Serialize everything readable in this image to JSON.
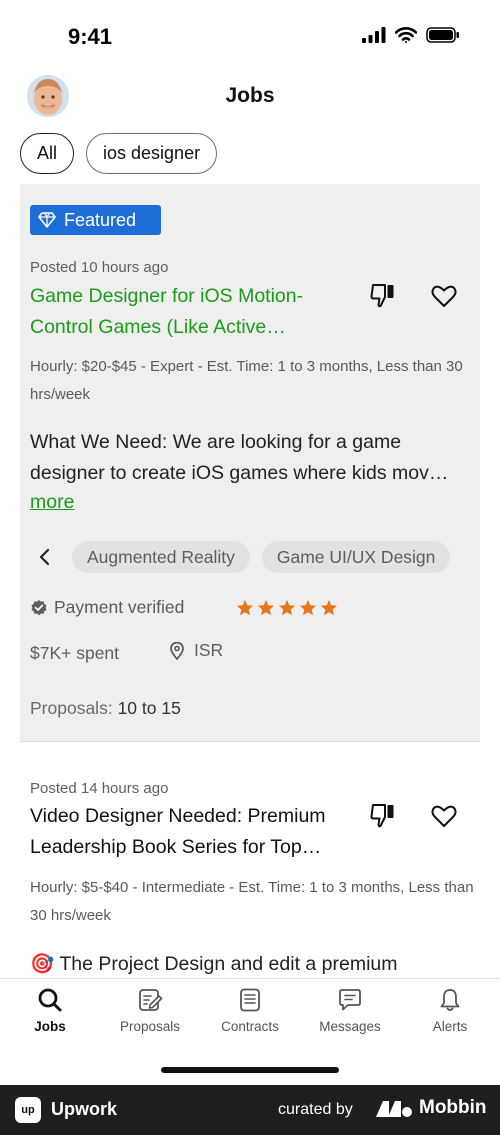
{
  "status_bar": {
    "time": "9:41"
  },
  "header": {
    "title": "Jobs"
  },
  "filters": [
    {
      "label": "All",
      "selected": true
    },
    {
      "label": "ios designer",
      "selected": false
    }
  ],
  "jobs": [
    {
      "featured_label": "Featured",
      "posted": "Posted 10 hours ago",
      "title": "Game Designer for iOS Motion-Control Games (Like Active…",
      "meta": "Hourly: $20-$45 - Expert - Est. Time: 1 to 3 months, Less than 30 hrs/week",
      "description": "What We Need: We are looking for a game designer to create iOS games where kids mov…",
      "more_label": "more",
      "tags": [
        "Augmented Reality",
        "Game UI/UX Design"
      ],
      "payment_status": "Payment verified",
      "rating": 5,
      "spent": "$7K+ spent",
      "location": "ISR",
      "proposals_label": "Proposals:",
      "proposals_value": "10 to 15"
    },
    {
      "posted": "Posted 14 hours ago",
      "title": "Video Designer Needed: Premium Leadership Book Series for Top…",
      "meta": "Hourly: $5-$40 - Intermediate - Est. Time: 1 to 3 months, Less than 30 hrs/week",
      "description": "🎯 The Project Design and edit a premium"
    }
  ],
  "tabbar": [
    {
      "label": "Jobs",
      "icon": "search-icon",
      "active": true
    },
    {
      "label": "Proposals",
      "icon": "proposals-icon",
      "active": false
    },
    {
      "label": "Contracts",
      "icon": "contracts-icon",
      "active": false
    },
    {
      "label": "Messages",
      "icon": "messages-icon",
      "active": false
    },
    {
      "label": "Alerts",
      "icon": "bell-icon",
      "active": false
    }
  ],
  "footer": {
    "app_name": "Upwork",
    "curated_by": "curated by",
    "brand": "Mobbin",
    "logo_text": "up"
  },
  "colors": {
    "accent_green": "#1a9c1a",
    "featured_blue": "#1f6ed8",
    "star_orange": "#e8751a"
  }
}
